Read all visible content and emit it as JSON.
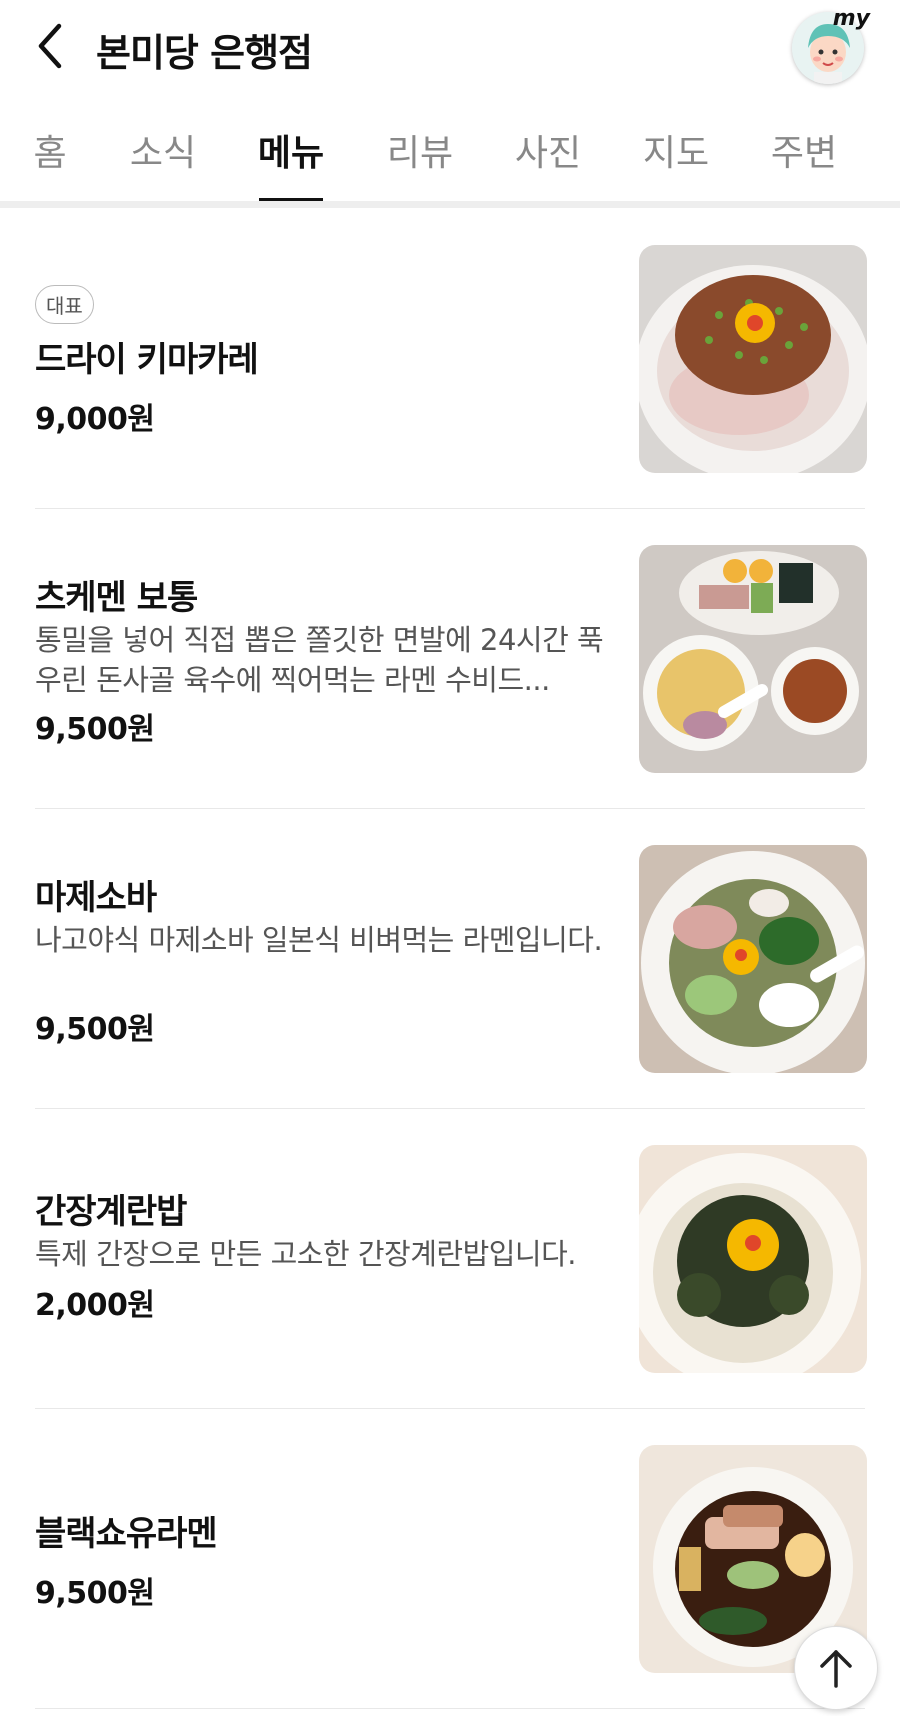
{
  "header": {
    "title": "본미당 은행점",
    "my_label": "my"
  },
  "tabs": [
    {
      "label": "홈"
    },
    {
      "label": "소식"
    },
    {
      "label": "메뉴"
    },
    {
      "label": "리뷰"
    },
    {
      "label": "사진"
    },
    {
      "label": "지도"
    },
    {
      "label": "주변"
    }
  ],
  "active_tab": "메뉴",
  "menu": [
    {
      "badge": "대표",
      "name": "드라이 키마카레",
      "desc": "",
      "price": "9,000원",
      "image": "keema-curry-bowl"
    },
    {
      "badge": "",
      "name": "츠케멘 보통",
      "desc": "통밀을 넣어 직접 뽑은 쫄깃한 면발에 24시간 푹 우린 돈사골 육수에 찍어먹는 라멘 수비드...",
      "price": "9,500원",
      "image": "tsukemen-set"
    },
    {
      "badge": "",
      "name": "마제소바",
      "desc": "나고야식 마제소바 일본식 비벼먹는 라멘입니다.",
      "price": "9,500원",
      "image": "mazesoba-bowl"
    },
    {
      "badge": "",
      "name": "간장계란밥",
      "desc": "특제 간장으로 만든 고소한 간장계란밥입니다.",
      "price": "2,000원",
      "image": "soy-egg-rice-bowl"
    },
    {
      "badge": "",
      "name": "블랙쇼유라멘",
      "desc": "",
      "price": "9,500원",
      "image": "black-shoyu-ramen-bowl"
    }
  ],
  "colors": {
    "accent": "#111111",
    "inactive_tab": "#888888",
    "divider": "#e8e8e8"
  }
}
